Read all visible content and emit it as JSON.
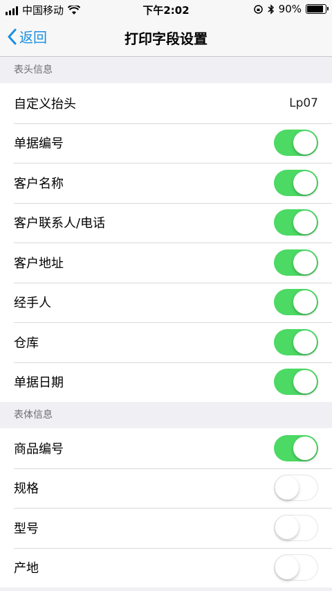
{
  "status_bar": {
    "carrier": "中国移动",
    "time": "下午2:02",
    "battery": "90%",
    "battery_level": 0.9,
    "icons": [
      "signal-icon",
      "wifi-icon",
      "orientation-lock-icon",
      "bluetooth-icon",
      "battery-icon"
    ]
  },
  "nav": {
    "back_label": "返回",
    "title": "打印字段设置"
  },
  "colors": {
    "accent": "#1a8fe0",
    "toggle_on": "#4cd964",
    "background": "#efeff4"
  },
  "sections": [
    {
      "header": "表头信息",
      "rows": [
        {
          "label": "自定义抬头",
          "value": "Lp07"
        },
        {
          "label": "单据编号",
          "toggle": true
        },
        {
          "label": "客户名称",
          "toggle": true
        },
        {
          "label": "客户联系人/电话",
          "toggle": true
        },
        {
          "label": "客户地址",
          "toggle": true
        },
        {
          "label": "经手人",
          "toggle": true
        },
        {
          "label": "仓库",
          "toggle": true
        },
        {
          "label": "单据日期",
          "toggle": true
        }
      ]
    },
    {
      "header": "表体信息",
      "rows": [
        {
          "label": "商品编号",
          "toggle": true
        },
        {
          "label": "规格",
          "toggle": false
        },
        {
          "label": "型号",
          "toggle": false
        },
        {
          "label": "产地",
          "toggle": false
        }
      ]
    }
  ]
}
